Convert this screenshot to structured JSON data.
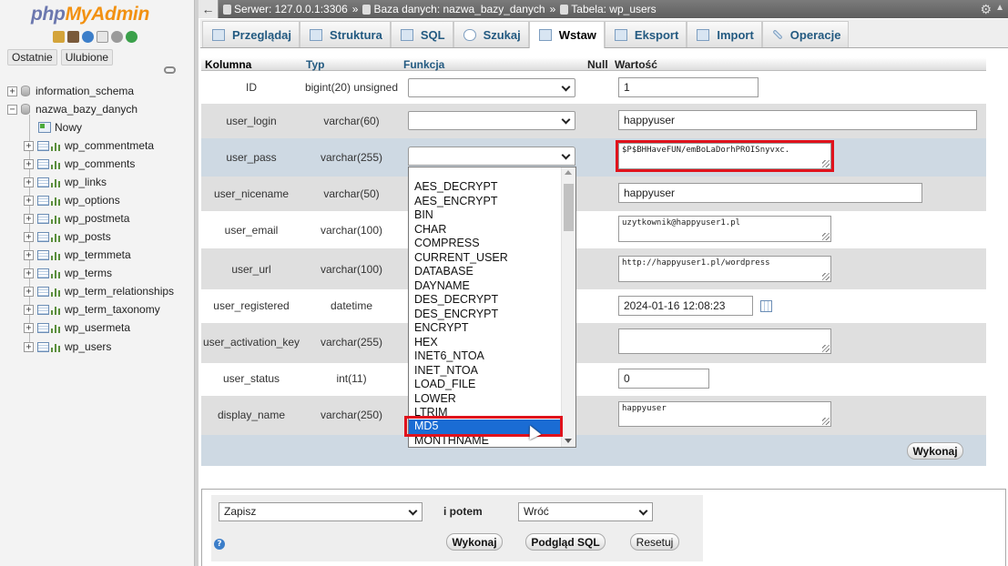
{
  "nav": {
    "logo": {
      "php": "php",
      "my": "My",
      "admin": "Admin"
    },
    "tabs": [
      "Ostatnie",
      "Ulubione"
    ],
    "tree": {
      "databases": [
        "information_schema",
        "nazwa_bazy_danych"
      ],
      "new_item": "Nowy",
      "tables": [
        "wp_commentmeta",
        "wp_comments",
        "wp_links",
        "wp_options",
        "wp_postmeta",
        "wp_posts",
        "wp_termmeta",
        "wp_terms",
        "wp_term_relationships",
        "wp_term_taxonomy",
        "wp_usermeta",
        "wp_users"
      ]
    }
  },
  "breadcrumb": {
    "server": "Serwer: 127.0.0.1:3306",
    "sep1": "»",
    "database": "Baza danych: nazwa_bazy_danych",
    "sep2": "»",
    "table": "Tabela: wp_users"
  },
  "tabs": [
    {
      "label": "Przeglądaj",
      "icon": "browse-icon"
    },
    {
      "label": "Struktura",
      "icon": "structure-icon"
    },
    {
      "label": "SQL",
      "icon": "sql-icon"
    },
    {
      "label": "Szukaj",
      "icon": "search-icon"
    },
    {
      "label": "Wstaw",
      "icon": "insert-icon",
      "active": true
    },
    {
      "label": "Eksport",
      "icon": "export-icon"
    },
    {
      "label": "Import",
      "icon": "import-icon"
    },
    {
      "label": "Operacje",
      "icon": "operations-icon"
    }
  ],
  "form": {
    "headers": {
      "column": "Kolumna",
      "type": "Typ",
      "function": "Funkcja",
      "null": "Null",
      "value": "Wartość"
    },
    "rows": [
      {
        "name": "ID",
        "type": "bigint(20) unsigned",
        "value": "1"
      },
      {
        "name": "user_login",
        "type": "varchar(60)",
        "value": "happyuser"
      },
      {
        "name": "user_pass",
        "type": "varchar(255)",
        "value": "$P$BHHaveFUN/emBoLaDorhPROISnyvxc."
      },
      {
        "name": "user_nicename",
        "type": "varchar(50)",
        "value": "happyuser"
      },
      {
        "name": "user_email",
        "type": "varchar(100)",
        "value": "uzytkownik@happyuser1.pl"
      },
      {
        "name": "user_url",
        "type": "varchar(100)",
        "value": "http://happyuser1.pl/wordpress"
      },
      {
        "name": "user_registered",
        "type": "datetime",
        "value": "2024-01-16 12:08:23"
      },
      {
        "name": "user_activation_key",
        "type": "varchar(255)",
        "value": ""
      },
      {
        "name": "user_status",
        "type": "int(11)",
        "value": "0"
      },
      {
        "name": "display_name",
        "type": "varchar(250)",
        "value": "happyuser"
      }
    ],
    "execute_label": "Wykonaj"
  },
  "function_dropdown": {
    "options": [
      "AES_DECRYPT",
      "AES_ENCRYPT",
      "BIN",
      "CHAR",
      "COMPRESS",
      "CURRENT_USER",
      "DATABASE",
      "DAYNAME",
      "DES_DECRYPT",
      "DES_ENCRYPT",
      "ENCRYPT",
      "HEX",
      "INET6_NTOA",
      "INET_NTOA",
      "LOAD_FILE",
      "LOWER",
      "LTRIM",
      "MD5",
      "MONTHNAME"
    ],
    "highlighted": "MD5"
  },
  "bottom": {
    "action_select": "Zapisz",
    "then_label": "i potem",
    "after_select": "Wróć",
    "execute_label": "Wykonaj",
    "preview_label": "Podgląd SQL",
    "reset_label": "Resetuj"
  },
  "colors": {
    "highlight_box": "#e0121c",
    "selected_option": "#1a6cd4",
    "tab_link": "#235a81"
  }
}
